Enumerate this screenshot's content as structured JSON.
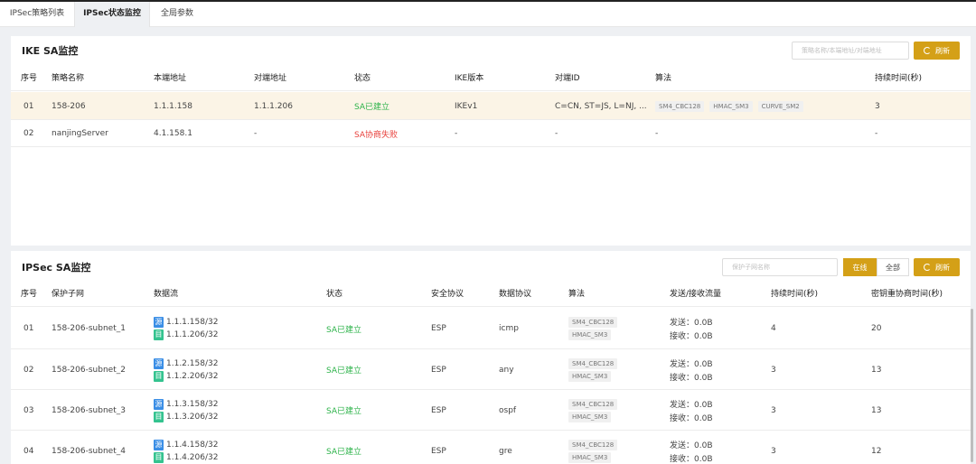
{
  "tabs": [
    "IPSec策略列表",
    "IPSec状态监控",
    "全局参数"
  ],
  "ike": {
    "title": "IKE SA监控",
    "search_placeholder": "策略名称/本端地址/对端地址",
    "refresh_label": "刷新",
    "headers": [
      "序号",
      "策略名称",
      "本端地址",
      "对端地址",
      "状态",
      "IKE版本",
      "对端ID",
      "算法",
      "持续时间(秒)"
    ],
    "rows": [
      {
        "idx": "01",
        "name": "158-206",
        "local": "1.1.1.158",
        "peer": "1.1.1.206",
        "status": "SA已建立",
        "version": "IKEv1",
        "peer_id": "C=CN, ST=JS, L=NJ, ...",
        "algs": [
          "SM4_CBC128",
          "HMAC_SM3",
          "CURVE_SM2"
        ],
        "duration": "3"
      },
      {
        "idx": "02",
        "name": "nanjingServer",
        "local": "4.1.158.1",
        "peer": "-",
        "status": "SA协商失败",
        "version": "-",
        "peer_id": "-",
        "algs": [
          "-"
        ],
        "duration": "-"
      }
    ]
  },
  "ipsec": {
    "title": "IPSec SA监控",
    "search_placeholder": "保护子网名称",
    "online_label": "在线",
    "all_label": "全部",
    "refresh_label": "刷新",
    "headers": [
      "序号",
      "保护子网",
      "数据流",
      "状态",
      "安全协议",
      "数据协议",
      "算法",
      "发送/接收流量",
      "持续时间(秒)",
      "密钥重协商时间(秒)"
    ],
    "src_badge": "源",
    "dst_badge": "目",
    "send_prefix": "发送：",
    "recv_prefix": "接收：",
    "rows": [
      {
        "idx": "01",
        "subnet": "158-206-subnet_1",
        "src": "1.1.1.158/32",
        "dst": "1.1.1.206/32",
        "status": "SA已建立",
        "sec": "ESP",
        "proto": "icmp",
        "alg1": "SM4_CBC128",
        "alg2": "HMAC_SM3",
        "send": "0.0B",
        "recv": "0.0B",
        "duration": "4",
        "rekey": "20"
      },
      {
        "idx": "02",
        "subnet": "158-206-subnet_2",
        "src": "1.1.2.158/32",
        "dst": "1.1.2.206/32",
        "status": "SA已建立",
        "sec": "ESP",
        "proto": "any",
        "alg1": "SM4_CBC128",
        "alg2": "HMAC_SM3",
        "send": "0.0B",
        "recv": "0.0B",
        "duration": "3",
        "rekey": "13"
      },
      {
        "idx": "03",
        "subnet": "158-206-subnet_3",
        "src": "1.1.3.158/32",
        "dst": "1.1.3.206/32",
        "status": "SA已建立",
        "sec": "ESP",
        "proto": "ospf",
        "alg1": "SM4_CBC128",
        "alg2": "HMAC_SM3",
        "send": "0.0B",
        "recv": "0.0B",
        "duration": "3",
        "rekey": "13"
      },
      {
        "idx": "04",
        "subnet": "158-206-subnet_4",
        "src": "1.1.4.158/32",
        "dst": "1.1.4.206/32",
        "status": "SA已建立",
        "sec": "ESP",
        "proto": "gre",
        "alg1": "SM4_CBC128",
        "alg2": "HMAC_SM3",
        "send": "0.0B",
        "recv": "0.0B",
        "duration": "3",
        "rekey": "12"
      }
    ]
  },
  "colors": {
    "accent": "#d4a017",
    "ok": "#2db34a",
    "fail": "#e8413c",
    "highlight_row": "#fbf4e6",
    "src_badge": "#3a8ee6",
    "dst_badge": "#34c38f"
  }
}
